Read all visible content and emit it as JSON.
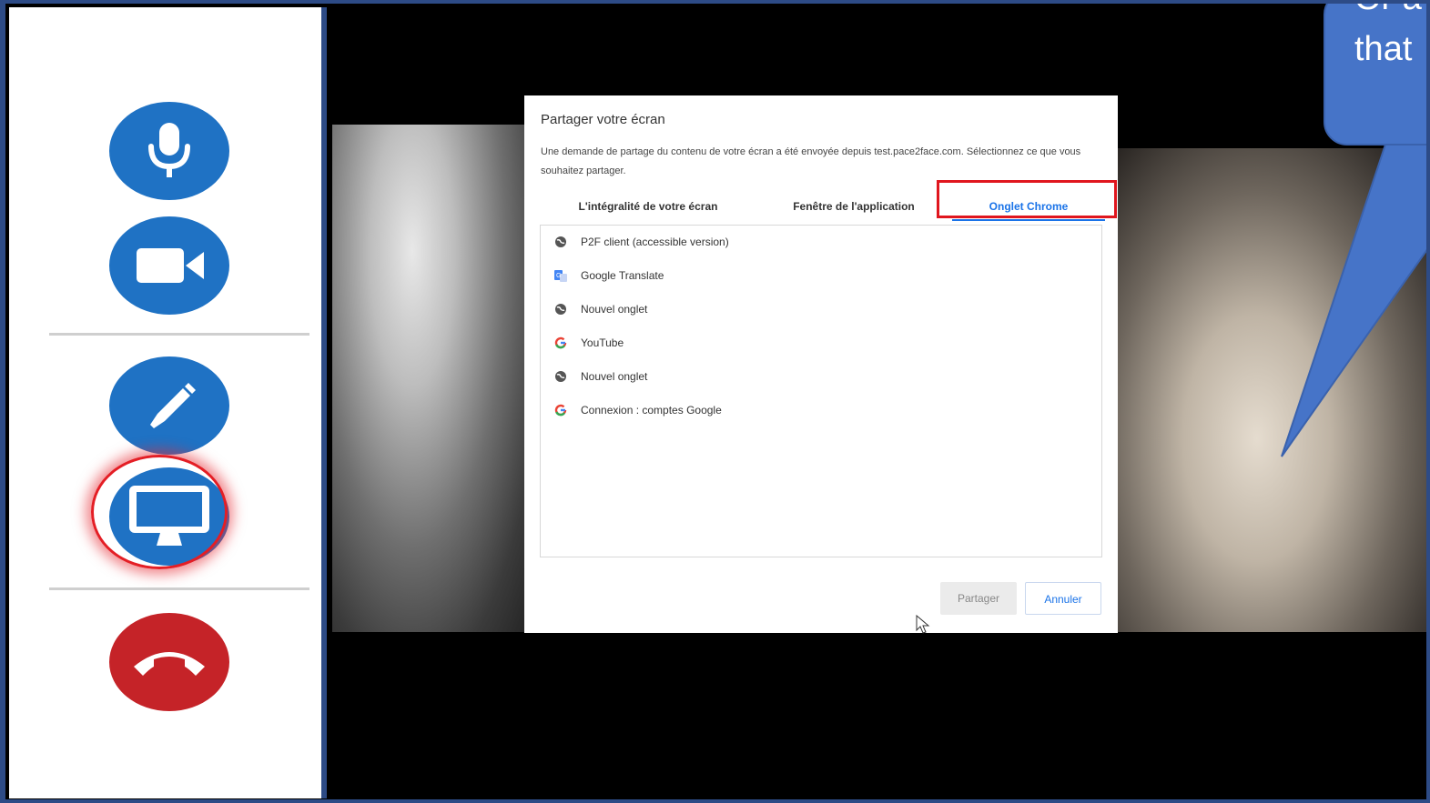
{
  "dialog": {
    "title": "Partager votre écran",
    "description": "Une demande de partage du contenu de votre écran a été envoyée depuis test.pace2face.com. Sélectionnez ce que vous souhaitez partager.",
    "tabs": [
      {
        "label": "L'intégralité de votre écran"
      },
      {
        "label": "Fenêtre de l'application"
      },
      {
        "label": "Onglet Chrome",
        "active": true
      }
    ],
    "items": [
      {
        "label": "P2F client (accessible version)",
        "icon": "globe-icon"
      },
      {
        "label": "Google Translate",
        "icon": "google-translate-icon"
      },
      {
        "label": "Nouvel onglet",
        "icon": "globe-icon"
      },
      {
        "label": "YouTube",
        "icon": "google-g-icon"
      },
      {
        "label": "Nouvel onglet",
        "icon": "globe-icon"
      },
      {
        "label": "Connexion : comptes Google",
        "icon": "google-g-icon"
      }
    ],
    "share_label": "Partager",
    "cancel_label": "Annuler"
  },
  "sidebar": {
    "buttons": [
      "microphone-icon",
      "camera-icon",
      "pen-icon",
      "screen-share-icon",
      "hang-up-icon"
    ]
  },
  "callout": {
    "text_line1": "Or a",
    "text_line2": "that"
  },
  "colors": {
    "frame": "#2d4b86",
    "button_blue": "#1f72c4",
    "button_red": "#c52328",
    "highlight_red": "#e0161e",
    "callout_blue": "#4674c8",
    "accent": "#1a73e8"
  }
}
